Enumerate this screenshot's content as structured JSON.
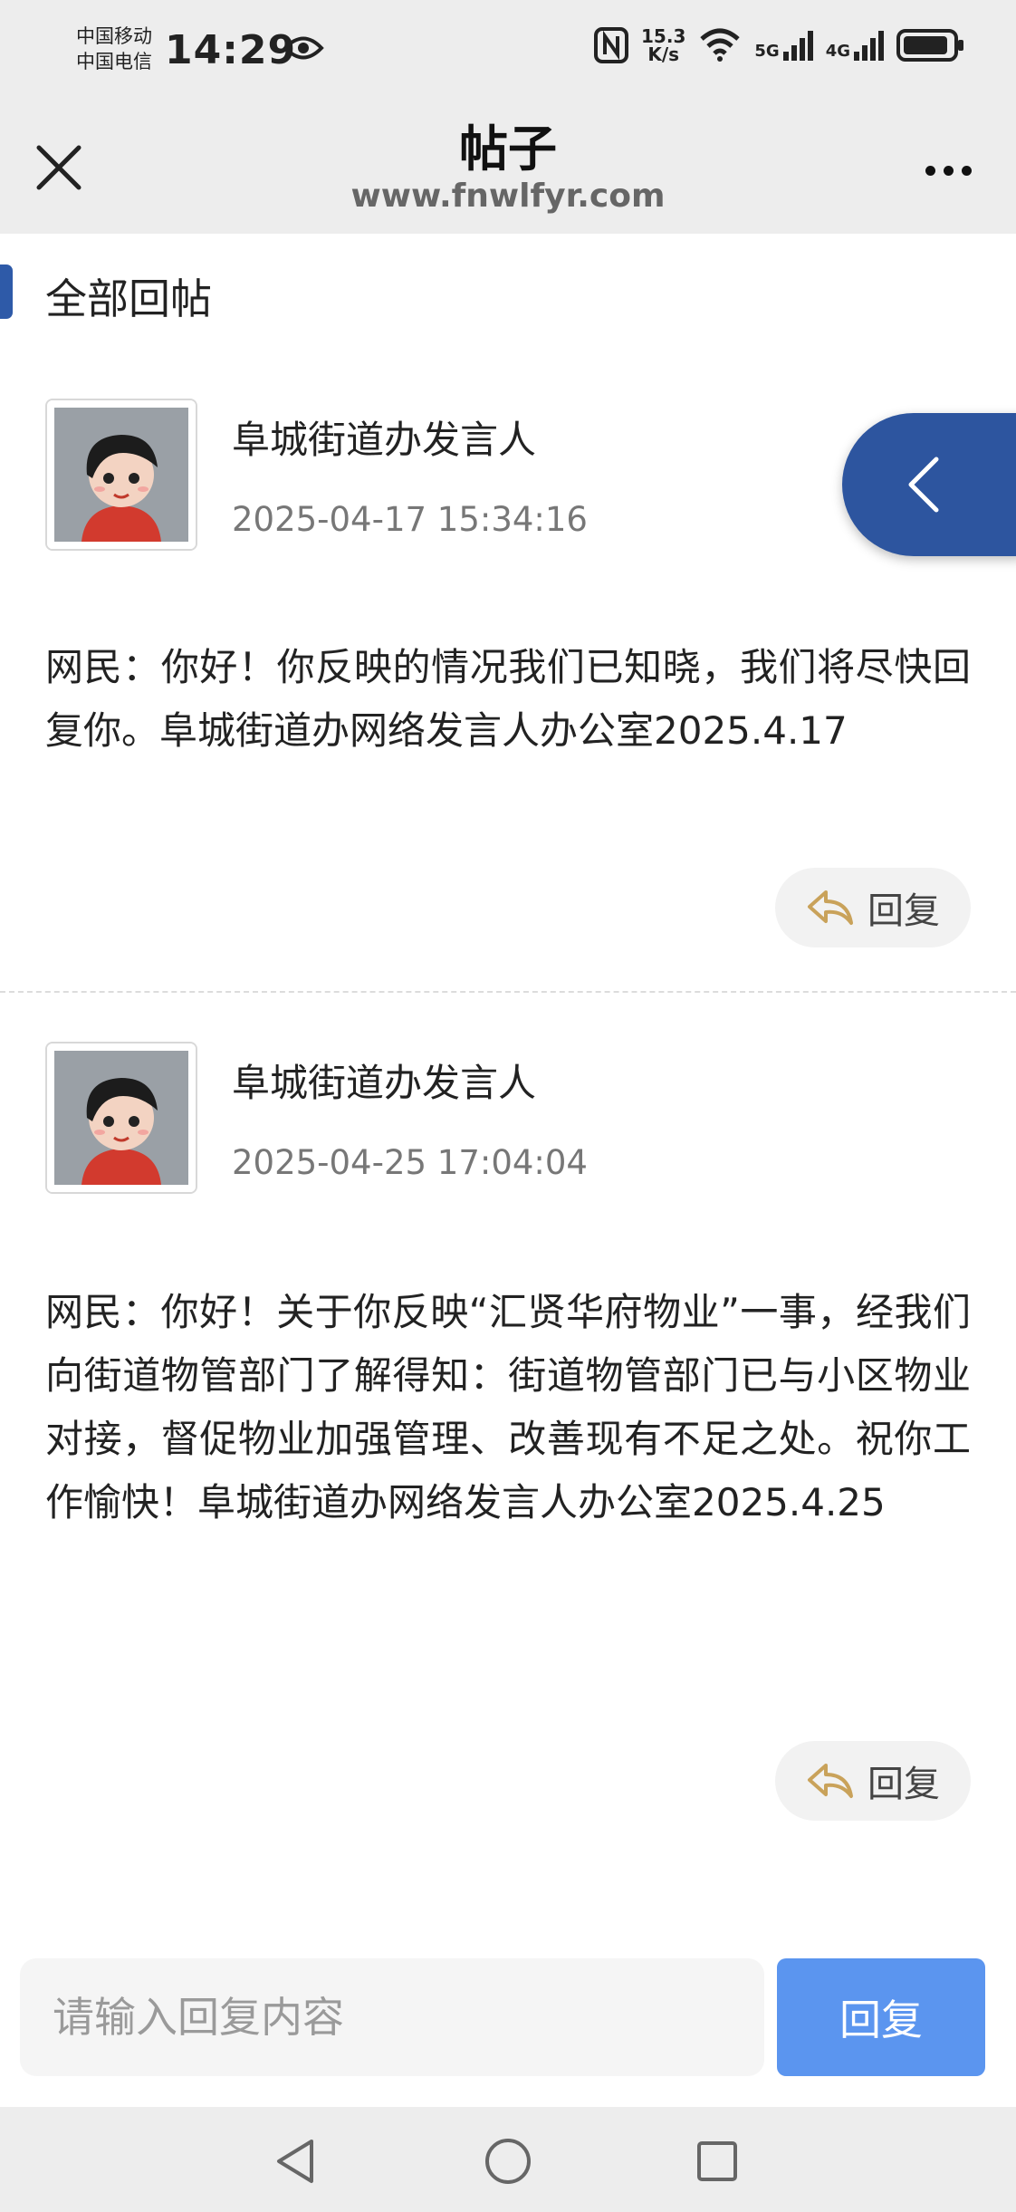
{
  "status_bar": {
    "carrier_1": "中国移动",
    "carrier_2": "中国电信",
    "time": "14:29",
    "net_speed_value": "15.3",
    "net_speed_unit": "K/s",
    "signal_1": "5G",
    "signal_2": "4G"
  },
  "nav": {
    "title": "帖子",
    "subtitle": "www.fnwlfyr.com"
  },
  "section": {
    "title": "全部回帖"
  },
  "posts": [
    {
      "author": "阜城街道办发言人",
      "time": "2025-04-17 15:34:16",
      "content": "网民：你好！你反映的情况我们已知晓，我们将尽快回复你。阜城街道办网络发言人办公室2025.4.17",
      "reply_label": "回复"
    },
    {
      "author": "阜城街道办发言人",
      "time": "2025-04-25 17:04:04",
      "content": "网民：你好！关于你反映“汇贤华府物业”一事，经我们向街道物管部门了解得知：街道物管部门已与小区物业对接，督促物业加强管理、改善现有不足之处。祝你工作愉快！阜城街道办网络发言人办公室2025.4.25",
      "reply_label": "回复"
    }
  ],
  "reply_bar": {
    "placeholder": "请输入回复内容",
    "submit_label": "回复"
  },
  "colors": {
    "accent": "#2e5aa8",
    "submit": "#5b95ef"
  }
}
